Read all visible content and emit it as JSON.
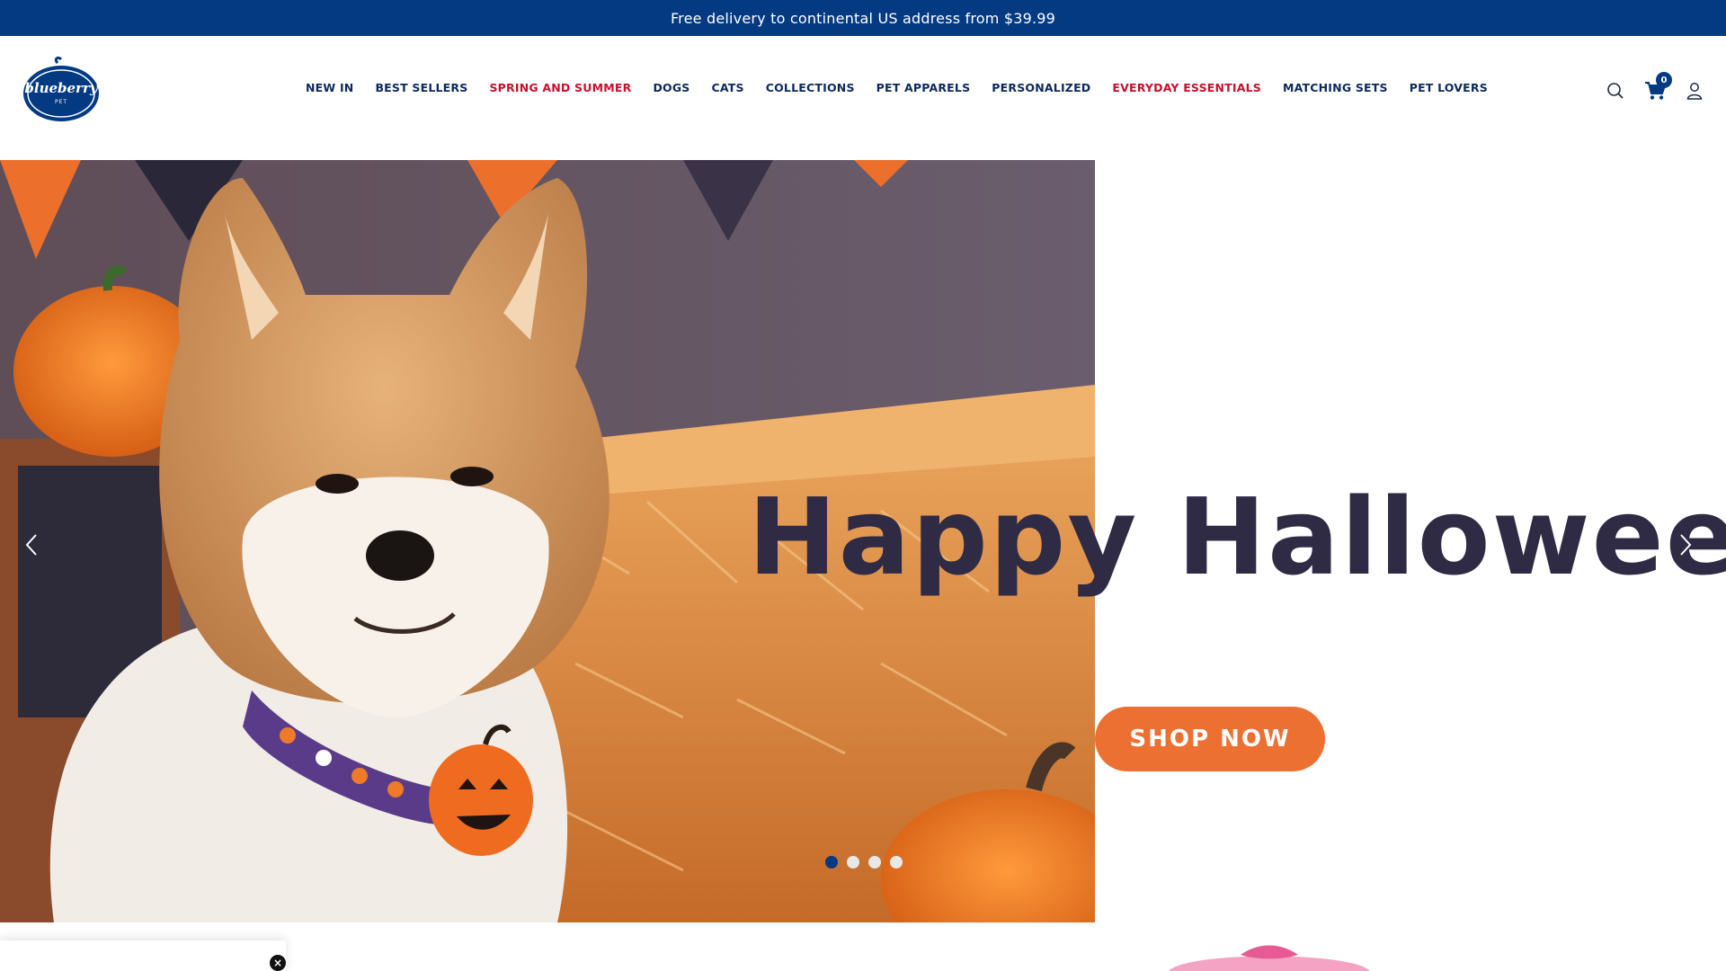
{
  "announcement": {
    "text": "Free delivery to continental US address from $39.99"
  },
  "logo": {
    "text": "blueberry",
    "subtext": "PET"
  },
  "nav": {
    "items": [
      {
        "label": "NEW IN",
        "color": "#0e2a5b"
      },
      {
        "label": "BEST SELLERS",
        "color": "#0e2a5b"
      },
      {
        "label": "SPRING AND SUMMER",
        "color": "#c8102e"
      },
      {
        "label": "DOGS",
        "color": "#0e2a5b"
      },
      {
        "label": "CATS",
        "color": "#0e2a5b"
      },
      {
        "label": "COLLECTIONS",
        "color": "#0e2a5b"
      },
      {
        "label": "PET APPARELS",
        "color": "#0e2a5b"
      },
      {
        "label": "PERSONALIZED",
        "color": "#0e2a5b"
      },
      {
        "label": "EVERYDAY ESSENTIALS",
        "color": "#c8102e"
      },
      {
        "label": "MATCHING SETS",
        "color": "#0e2a5b"
      },
      {
        "label": "PET LOVERS",
        "color": "#0e2a5b"
      }
    ]
  },
  "header": {
    "icons": [
      "search-icon",
      "cart-icon",
      "account-icon"
    ],
    "cart_count": "0"
  },
  "hero": {
    "title": "Happy Halloween",
    "cta_label": "SHOP NOW",
    "slides": 4,
    "active_slide": 1,
    "colors": {
      "brand": "#033a82",
      "cta": "#ec7032",
      "title": "#2f2b45"
    }
  },
  "popup": {
    "close_label": "×"
  }
}
